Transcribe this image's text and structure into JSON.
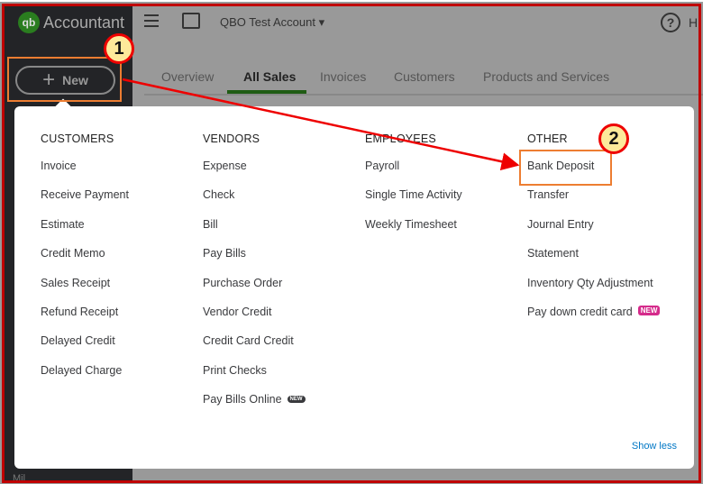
{
  "sidebar": {
    "logo_text": "Accountant",
    "new_label": "New",
    "bottom_text": "Mil"
  },
  "header": {
    "account": "QBO Test Account ▾",
    "help": "?",
    "help_label": "H"
  },
  "tabs": [
    {
      "label": "Overview"
    },
    {
      "label": "All Sales"
    },
    {
      "label": "Invoices"
    },
    {
      "label": "Customers"
    },
    {
      "label": "Products and Services"
    }
  ],
  "menu": {
    "columns": [
      {
        "heading": "CUSTOMERS",
        "items": [
          "Invoice",
          "Receive Payment",
          "Estimate",
          "Credit Memo",
          "Sales Receipt",
          "Refund Receipt",
          "Delayed Credit",
          "Delayed Charge"
        ]
      },
      {
        "heading": "VENDORS",
        "items": [
          "Expense",
          "Check",
          "Bill",
          "Pay Bills",
          "Purchase Order",
          "Vendor Credit",
          "Credit Card Credit",
          "Print Checks",
          "Pay Bills Online"
        ]
      },
      {
        "heading": "EMPLOYEES",
        "items": [
          "Payroll",
          "Single Time Activity",
          "Weekly Timesheet"
        ]
      },
      {
        "heading": "OTHER",
        "items": [
          "Bank Deposit",
          "Transfer",
          "Journal Entry",
          "Statement",
          "Inventory Qty Adjustment",
          "Pay down credit card"
        ]
      }
    ],
    "badge_new": "NEW",
    "show_less": "Show less"
  },
  "callouts": [
    "1",
    "2"
  ],
  "colors": {
    "badge_pink": "#d52b8b",
    "badge_dark": "#393a3d",
    "link": "#0077c5",
    "callout_ring": "#ee0000"
  }
}
